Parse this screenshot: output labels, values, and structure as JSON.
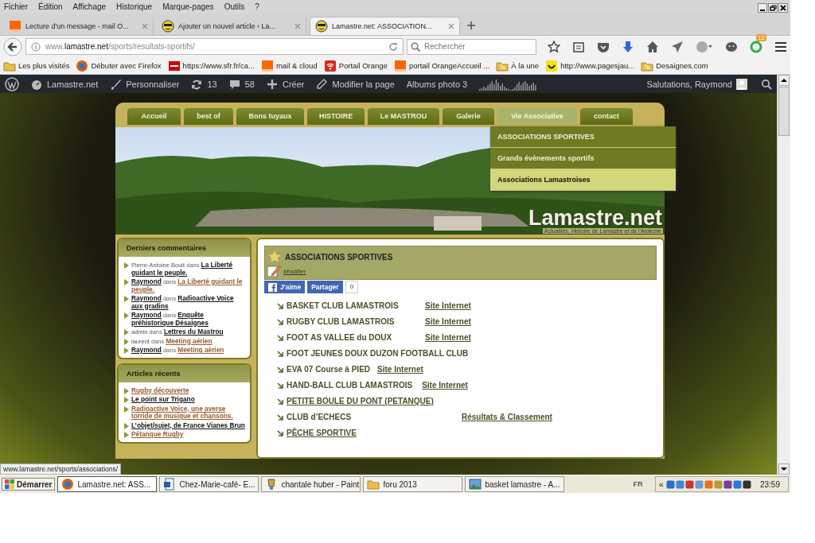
{
  "menu_bar": {
    "items": [
      "Fichier",
      "Édition",
      "Affichage",
      "Historique",
      "Marque-pages",
      "Outils",
      "?"
    ]
  },
  "tabs": [
    {
      "title": "Lecture d'un message - mail O...",
      "selected": false
    },
    {
      "title": "Ajouter un nouvel article ‹ La...",
      "selected": false
    },
    {
      "title": "Lamastre.net: ASSOCIATION...",
      "selected": true
    }
  ],
  "address_bar": {
    "url": "www.**lamastre.net**/sports/resultats-sportifs/"
  },
  "search": {
    "placeholder": "Rechercher"
  },
  "toolbar": {
    "badge": "12"
  },
  "bookmarks": [
    {
      "label": "Les plus visités"
    },
    {
      "label": "Débuter avec Firefox"
    },
    {
      "label": "https://www.sfr.fr/ca..."
    },
    {
      "label": "mail & cloud"
    },
    {
      "label": "Portail Orange"
    },
    {
      "label": "portail OrangeAccueil ..."
    },
    {
      "label": "À la une"
    },
    {
      "label": "http://www.pagesjau..."
    },
    {
      "label": "Desaignes.com"
    }
  ],
  "admin_bar": {
    "items": [
      {
        "kind": "site",
        "label": "Lamastre.net"
      },
      {
        "kind": "customize",
        "label": "Personnaliser"
      },
      {
        "kind": "updates",
        "label": "13"
      },
      {
        "kind": "comments",
        "label": "58"
      },
      {
        "kind": "new",
        "label": "Créer"
      },
      {
        "kind": "edit",
        "label": "Modifier la page"
      },
      {
        "kind": "plain",
        "label": "Albums photo 3"
      }
    ],
    "greeting": "Salutations, Raymond"
  },
  "site": {
    "nav": [
      {
        "label": "Accueil",
        "selected": false
      },
      {
        "label": "best of",
        "selected": false
      },
      {
        "label": "Bons tuyaux",
        "selected": false
      },
      {
        "label": "HISTOIRE",
        "selected": false
      },
      {
        "label": "Le MASTROU",
        "selected": false
      },
      {
        "label": "Galerie",
        "selected": false
      },
      {
        "label": "Vie Associative",
        "selected": true
      },
      {
        "label": "contact",
        "selected": false
      }
    ],
    "dropdown": [
      {
        "label": "ASSOCIATIONS SPORTIVES",
        "selected": false
      },
      {
        "label": "Grands évènements sportifs",
        "selected": false
      },
      {
        "label": "Associations Lamastroises",
        "selected": true
      }
    ],
    "header": {
      "title": "Lamastre.net",
      "tagline": "Actualités, Histoire de Lamastre et de l'Ardèche"
    },
    "sidebar": [
      {
        "title": "Derniers commentaires",
        "kind": "comments",
        "items": [
          {
            "author": "Pierre-Antoine Bouit",
            "author_link": false,
            "joiner": "dans",
            "post": "La Liberté guidant le peuple.",
            "visited": false
          },
          {
            "author": "Raymond",
            "author_link": true,
            "joiner": "dans",
            "post": "La Liberté guidant le peuple.",
            "visited": true
          },
          {
            "author": "Raymond",
            "author_link": true,
            "joiner": "dans",
            "post": "Radioactive Voice aux gradins",
            "visited": false
          },
          {
            "author": "Raymond",
            "author_link": true,
            "joiner": "dans",
            "post": "Enquête préhistorique Désaignes",
            "visited": false
          },
          {
            "author": "admin",
            "author_link": false,
            "joiner": "dans",
            "post": "Lettres du Mastrou",
            "visited": false
          },
          {
            "author": "laurent",
            "author_link": false,
            "joiner": "dans",
            "post": "Meeting aérien",
            "visited": true
          },
          {
            "author": "Raymond",
            "author_link": true,
            "joiner": "dans",
            "post": "Meeting aérien",
            "visited": true
          }
        ]
      },
      {
        "title": "Articles récents",
        "kind": "posts",
        "items": [
          {
            "post": "Rugby découverte",
            "visited": true
          },
          {
            "post": "Le point sur Trigano",
            "visited": false
          },
          {
            "post": "Radioactive Voice, une averse torride de musique et chansons.",
            "visited": true
          },
          {
            "post": "L’objet/sujet, de France Vianes Brun",
            "visited": false
          },
          {
            "post": "Pétanque Rugby",
            "visited": true
          }
        ]
      }
    ],
    "article": {
      "title": "ASSOCIATIONS SPORTIVES",
      "edit_link": "Modifier",
      "like": "J'aime",
      "share": "Partager",
      "share_count": "0",
      "items": [
        {
          "name": "BASKET CLUB LAMASTROIS",
          "name_link": false,
          "link": "Site Internet"
        },
        {
          "name": "RUGBY CLUB LAMASTROIS",
          "name_link": false,
          "link": "Site Internet"
        },
        {
          "name": "FOOT AS VALLEE du DOUX",
          "name_link": false,
          "link": "Site Internet"
        },
        {
          "name": "FOOT JEUNES DOUX DUZON FOOTBALL CLUB",
          "name_link": false
        },
        {
          "name": "EVA 07 Course à PIED",
          "name_link": false,
          "link": "Site Internet"
        },
        {
          "name": "HAND-BALL CLUB LAMASTROIS",
          "name_link": false,
          "link": "Site Internet"
        },
        {
          "name": "PETITE BOULE DU PONT (PETANQUE)",
          "name_link": true
        },
        {
          "name": "CLUB d’ECHECS",
          "name_link": false,
          "link": "Résultats & Classement"
        },
        {
          "name": "PÊCHE SPORTIVE",
          "name_link": true
        }
      ]
    }
  },
  "status_text": "www.lamastre.net/sports/associations/",
  "taskbar": {
    "start": "Démarrer",
    "tasks": [
      {
        "label": "Lamastre.net: ASS...",
        "selected": true
      },
      {
        "label": "Chez-Marie-café- E...",
        "selected": false
      },
      {
        "label": "chantale huber - Paint",
        "selected": false
      },
      {
        "label": "foru 2013",
        "selected": false
      },
      {
        "label": "basket lamastre - A...",
        "selected": false
      }
    ],
    "language": "FR",
    "tray_toggle": "«",
    "clock": "23:59"
  }
}
